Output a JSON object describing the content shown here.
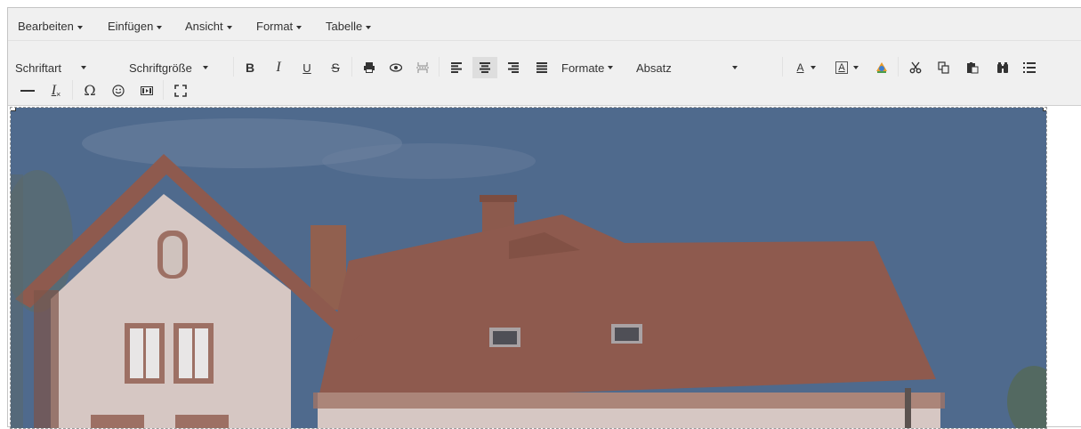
{
  "menubar": {
    "items": [
      "Bearbeiten",
      "Einfügen",
      "Ansicht",
      "Format",
      "Tabelle"
    ]
  },
  "toolbar": {
    "font_family_label": "Schriftart",
    "font_size_label": "Schriftgröße",
    "bold_label": "B",
    "italic_label": "I",
    "underline_label": "U",
    "strike_label": "S",
    "formats_label": "Formate",
    "paragraph_label": "Absatz",
    "text_color_label": "A",
    "bg_color_label": "A",
    "special_char_label": "Ω",
    "clear_format_label": "I"
  },
  "icons": {
    "print": "print-icon",
    "preview": "preview-icon",
    "pagebreak": "pagebreak-icon",
    "align_left": "align-left-icon",
    "align_center": "align-center-icon",
    "align_right": "align-right-icon",
    "align_justify": "align-justify-icon",
    "find": "binoculars-icon",
    "list": "bullet-list-icon",
    "hr": "horizontal-rule-icon",
    "emoji": "emoticon-icon",
    "media": "media-icon",
    "fullscreen": "fullscreen-icon"
  },
  "colors": {
    "sky": "#4f6a8d",
    "roof": "#8e5a4e",
    "wall": "#d6c7c3"
  }
}
